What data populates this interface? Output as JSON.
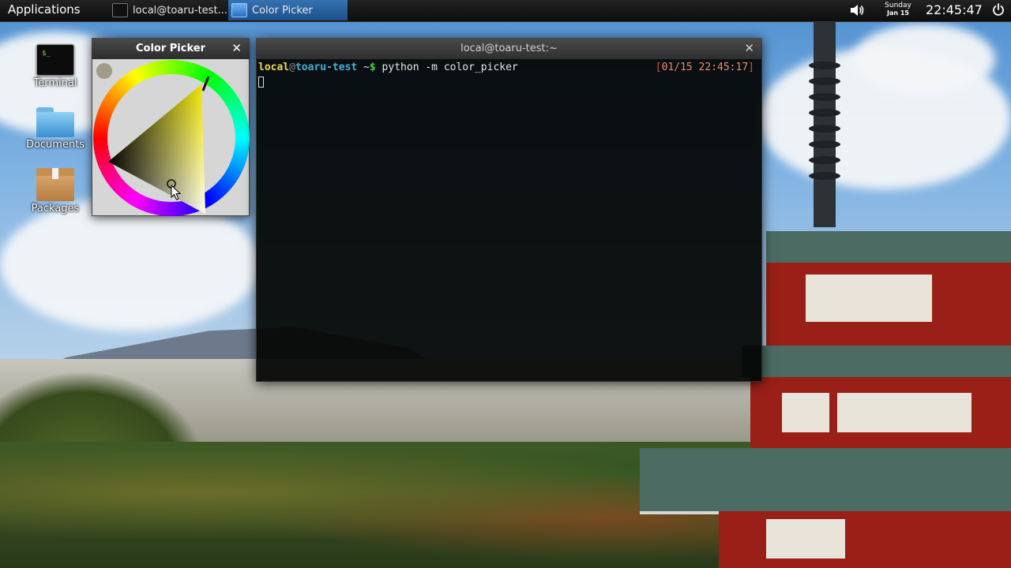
{
  "panel": {
    "applications_label": "Applications",
    "tasks": [
      {
        "label": "local@toaru-test..."
      },
      {
        "label": "Color Picker"
      }
    ],
    "date_day": "Sunday",
    "date_md": "Jan 15",
    "clock": "22:45:47"
  },
  "desktop_icons": [
    {
      "label": "Terminal"
    },
    {
      "label": "Documents"
    },
    {
      "label": "Packages"
    }
  ],
  "color_picker": {
    "title": "Color Picker",
    "close_glyph": "✕",
    "hue_color": "#f5ea00",
    "selected_color": "#a09c88",
    "selected_hue_deg": 60
  },
  "terminal": {
    "title": "local@toaru-test:~",
    "close_glyph": "✕",
    "prompt_user": "local",
    "prompt_at": "@",
    "prompt_host": "toaru-test",
    "prompt_dir": " ~",
    "prompt_sign": "$",
    "command": " python -m color_picker",
    "ts_open": "[",
    "timestamp": "01/15 22:45:17",
    "ts_close": "]"
  }
}
